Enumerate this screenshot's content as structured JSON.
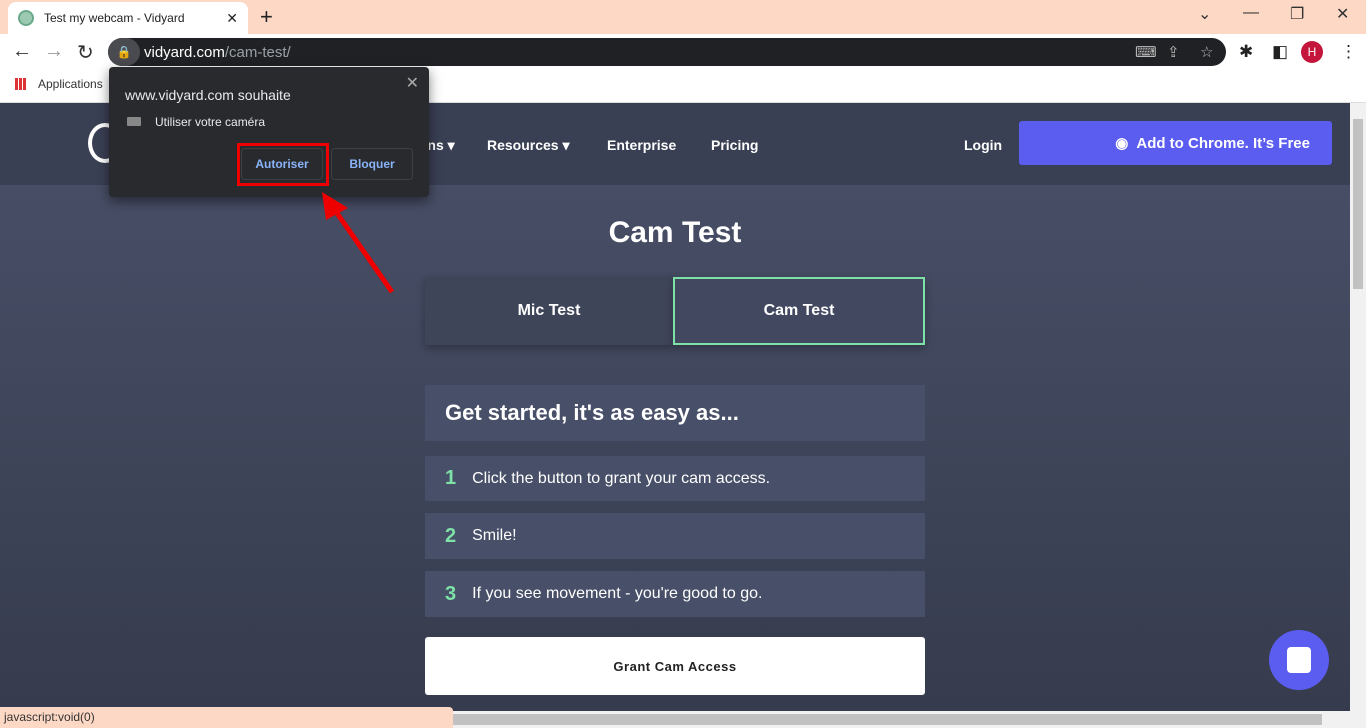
{
  "browser": {
    "tab_title": "Test my webcam - Vidyard",
    "url_domain": "vidyard.com",
    "url_path": "/cam-test/",
    "bookmark": "Applications",
    "profile_initial": "H",
    "status_text": "javascript:void(0)"
  },
  "permission_popup": {
    "title": "www.vidyard.com souhaite",
    "permission": "Utiliser votre caméra",
    "allow": "Autoriser",
    "block": "Bloquer"
  },
  "header": {
    "nav": [
      {
        "label": "Solutions"
      },
      {
        "label": "Resources"
      },
      {
        "label": "Enterprise"
      },
      {
        "label": "Pricing"
      }
    ],
    "login": "Login",
    "cta": "Add to Chrome. It’s Free"
  },
  "main": {
    "title": "Cam Test",
    "tabs": [
      {
        "label": "Mic Test"
      },
      {
        "label": "Cam Test"
      }
    ],
    "steps_title": "Get started, it's as easy as...",
    "steps": [
      {
        "num": "1",
        "text": "Click the button to grant your cam access."
      },
      {
        "num": "2",
        "text": "Smile!"
      },
      {
        "num": "3",
        "text": "If you see movement - you're good to go."
      }
    ],
    "grant_button": "Grant Cam Access"
  },
  "colors": {
    "accent": "#5b5cf0",
    "green": "#7ee2a8",
    "highlight": "#e00000"
  }
}
